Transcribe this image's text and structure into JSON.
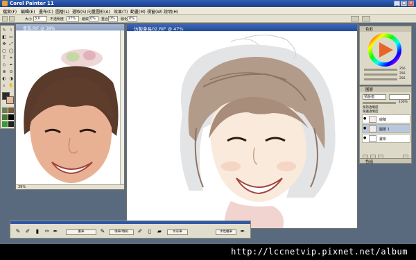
{
  "app": {
    "title": "Corel Painter 11",
    "window_controls": [
      "_",
      "□",
      "×"
    ]
  },
  "menu": [
    "檔案(F)",
    "編輯(E)",
    "畫布(C)",
    "圖層(L)",
    "選取(S)",
    "向量圖形(A)",
    "效果(T)",
    "動畫(M)",
    "視窗(W)",
    "說明(H)"
  ],
  "property_bar": {
    "size_label": "大小",
    "size_value": "3.0",
    "opacity_label": "不透明度",
    "opacity_value": "37%",
    "grain_label": "紙紋",
    "grain_value": "0%",
    "resat_label": "重合",
    "resat_value": "0%",
    "bleed_label": "融化",
    "bleed_value": "0%"
  },
  "reference_window": {
    "title": "會長.RIF @ 38%",
    "zoom": "39%"
  },
  "main_window": {
    "title": "仿製會長02.RIF @ 47%"
  },
  "color_panel": {
    "title": "色彩",
    "values": [
      "256",
      "256",
      "256"
    ],
    "hue_ring_colors": [
      "#ff0000",
      "#ffff00",
      "#00ff00",
      "#00ffff",
      "#0000ff",
      "#ff00ff",
      "#ff0000"
    ],
    "main_color": "#e8652a"
  },
  "layers_panel": {
    "title": "圖層",
    "composite_method": "預設值",
    "opacity_value": "100%",
    "options": [
      "保持透明度",
      "保護透明度"
    ],
    "layers": [
      {
        "name": "線稿",
        "visible": true,
        "selected": false
      },
      {
        "name": "圖層 1",
        "visible": true,
        "selected": true
      },
      {
        "name": "畫布",
        "visible": true,
        "selected": false
      }
    ]
  },
  "color_sets": {
    "title": "色組"
  },
  "brush_bar": {
    "labels": [
      "畫筆",
      "噴筆/噴刷",
      "水彩筆",
      "水性蠟筆"
    ],
    "icons": [
      "brush-icon",
      "airbrush-icon",
      "watercolor-icon",
      "pastel-icon"
    ]
  },
  "watermark": {
    "text": "http://lccnetvip.pixnet.net/album"
  }
}
